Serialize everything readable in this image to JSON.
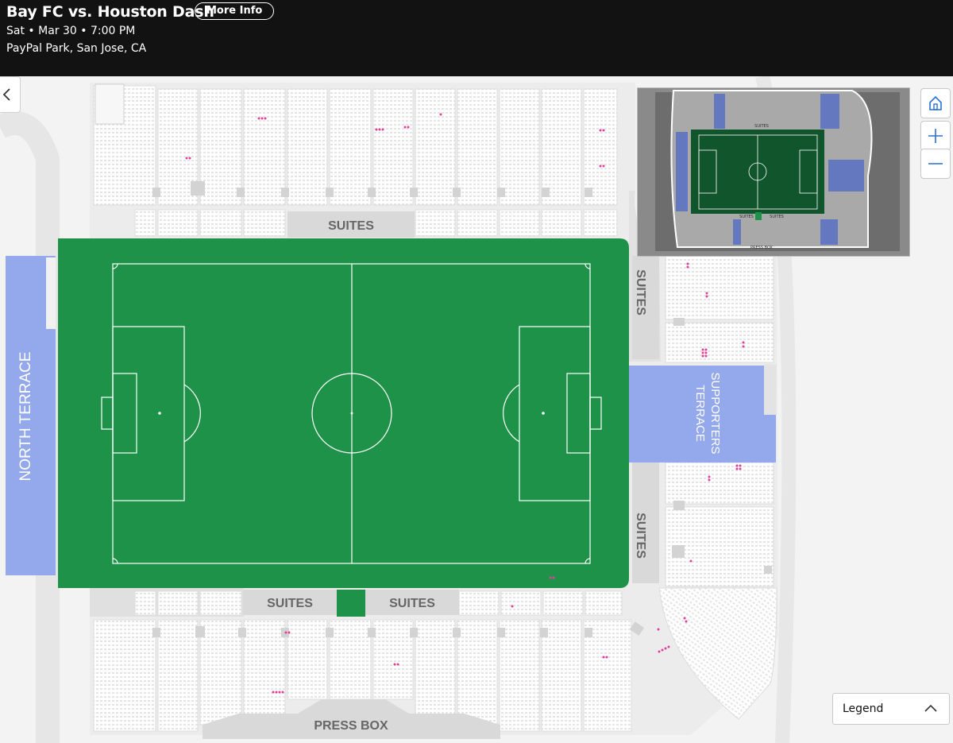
{
  "event": {
    "title": "Bay FC vs. Houston Dash",
    "more_info_label": "More Info",
    "datetime": "Sat • Mar 30 • 7:00 PM",
    "venue": "PayPal Park, San Jose, CA"
  },
  "map": {
    "north_terrace": "NORTH TERRACE",
    "supporters_terrace_line1": "SUPPORTERS",
    "supporters_terrace_line2": "TERRACE",
    "suites": "SUITES",
    "press_box": "PRESS BOX",
    "minimap_suites": "SUITES",
    "minimap_press_box": "PRESS BOX"
  },
  "controls": {
    "home_icon": "home-icon",
    "zoom_in_icon": "plus-icon",
    "zoom_out_icon": "minus-icon",
    "back_icon": "chevron-left-icon"
  },
  "legend": {
    "label": "Legend",
    "icon": "chevron-up-icon"
  },
  "colors": {
    "header_bg": "#121212",
    "pitch": "#1f9249",
    "terrace": "#94a8ec",
    "suites": "#d9d9d9",
    "available_seat": "#e0409a"
  }
}
